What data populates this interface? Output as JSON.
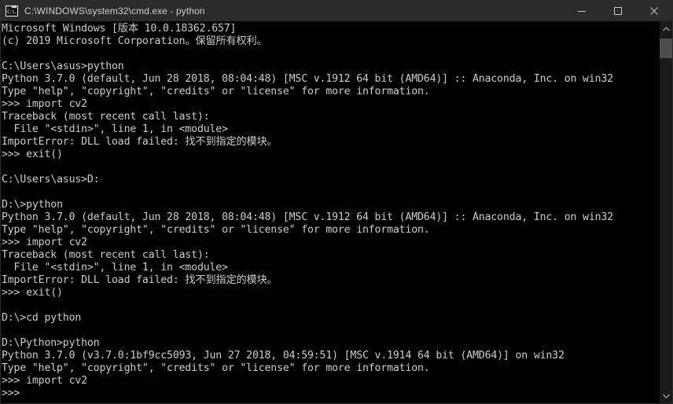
{
  "window": {
    "title": "C:\\WINDOWS\\system32\\cmd.exe - python",
    "icon": "cmd-icon",
    "icon_text": "C:\\.",
    "background_color": "#000000",
    "titlebar_color": "#2b2b2b",
    "text_color": "#cccccc"
  },
  "controls": {
    "minimize_label": "Minimize",
    "maximize_label": "Maximize",
    "close_label": "Close"
  },
  "scrollbar": {
    "up_label": "Scroll up",
    "down_label": "Scroll down",
    "thumb_label": "Scroll thumb"
  },
  "console": {
    "lines": [
      "Microsoft Windows [版本 10.0.18362.657]",
      "(c) 2019 Microsoft Corporation。保留所有权利。",
      "",
      "C:\\Users\\asus>python",
      "Python 3.7.0 (default, Jun 28 2018, 08:04:48) [MSC v.1912 64 bit (AMD64)] :: Anaconda, Inc. on win32",
      "Type \"help\", \"copyright\", \"credits\" or \"license\" for more information.",
      ">>> import cv2",
      "Traceback (most recent call last):",
      "  File \"<stdin>\", line 1, in <module>",
      "ImportError: DLL load failed: 找不到指定的模块。",
      ">>> exit()",
      "",
      "C:\\Users\\asus>D:",
      "",
      "D:\\>python",
      "Python 3.7.0 (default, Jun 28 2018, 08:04:48) [MSC v.1912 64 bit (AMD64)] :: Anaconda, Inc. on win32",
      "Type \"help\", \"copyright\", \"credits\" or \"license\" for more information.",
      ">>> import cv2",
      "Traceback (most recent call last):",
      "  File \"<stdin>\", line 1, in <module>",
      "ImportError: DLL load failed: 找不到指定的模块。",
      ">>> exit()",
      "",
      "D:\\>cd python",
      "",
      "D:\\Python>python",
      "Python 3.7.0 (v3.7.0:1bf9cc5093, Jun 27 2018, 04:59:51) [MSC v.1914 64 bit (AMD64)] on win32",
      "Type \"help\", \"copyright\", \"credits\" or \"license\" for more information.",
      ">>> import cv2",
      ">>>"
    ]
  }
}
